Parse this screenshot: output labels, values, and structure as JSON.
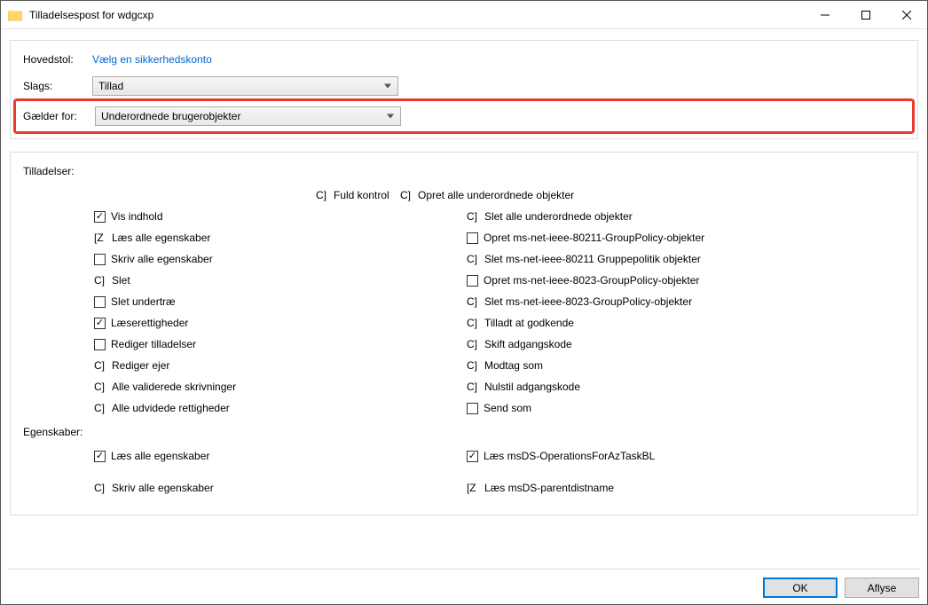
{
  "window": {
    "title": "Tilladelsespost for wdgcxp"
  },
  "form": {
    "principal_label": "Hovedstol:",
    "principal_link": "Vælg en sikkerhedskonto",
    "type_label": "Slags:",
    "type_value": "Tillad",
    "applies_label": "Gælder for:",
    "applies_value": "Underordnede brugerobjekter"
  },
  "permissions_label": "Tilladelser:",
  "properties_label": "Egenskaber:",
  "perm_left": [
    {
      "marker": "C]",
      "label": "Fuld kontrol"
    },
    {
      "checkbox": true,
      "checked": true,
      "label": "Vis indhold"
    },
    {
      "marker": "[Z",
      "label": "Læs alle egenskaber"
    },
    {
      "checkbox": true,
      "checked": false,
      "label": "Skriv alle egenskaber"
    },
    {
      "marker": "C]",
      "label": "Slet"
    },
    {
      "checkbox": true,
      "checked": false,
      "label": "Slet undertræ"
    },
    {
      "checkbox": true,
      "checked": true,
      "label": "Læserettigheder"
    },
    {
      "checkbox": true,
      "checked": false,
      "label": "Rediger tilladelser"
    },
    {
      "marker": "C]",
      "label": "Rediger ejer"
    },
    {
      "marker": "C]",
      "label": "Alle validerede skrivninger"
    },
    {
      "marker": "C]",
      "label": "Alle udvidede rettigheder"
    }
  ],
  "perm_right": [
    {
      "marker": "C]",
      "label": "Opret alle underordnede objekter"
    },
    {
      "marker": "C]",
      "label": "Slet alle underordnede objekter"
    },
    {
      "checkbox": true,
      "checked": false,
      "label": "Opret ms-net-ieee-80211-GroupPolicy-objekter"
    },
    {
      "marker": "C]",
      "label": "Slet ms-net-ieee-80211 Gruppepolitik objekter"
    },
    {
      "checkbox": true,
      "checked": false,
      "label": "Opret ms-net-ieee-8023-GroupPolicy-objekter"
    },
    {
      "marker": "C]",
      "label": "Slet ms-net-ieee-8023-GroupPolicy-objekter"
    },
    {
      "marker": "C]",
      "label": "Tilladt at godkende"
    },
    {
      "marker": "C]",
      "label": "Skift adgangskode"
    },
    {
      "marker": "C]",
      "label": "Modtag som"
    },
    {
      "marker": "C]",
      "label": "Nulstil adgangskode"
    },
    {
      "checkbox": true,
      "checked": false,
      "label": "Send som"
    }
  ],
  "prop_left": [
    {
      "checkbox": true,
      "checked": true,
      "label": "Læs alle egenskaber"
    },
    {
      "spacer": true
    },
    {
      "marker": "C]",
      "label": "Skriv alle egenskaber"
    }
  ],
  "prop_right": [
    {
      "checkbox": true,
      "checked": true,
      "label": "Læs msDS-OperationsForAzTaskBL"
    },
    {
      "spacer": true
    },
    {
      "marker": "[Z",
      "label": "Læs msDS-parentdistname"
    }
  ],
  "buttons": {
    "ok": "OK",
    "cancel": "Aflyse"
  }
}
